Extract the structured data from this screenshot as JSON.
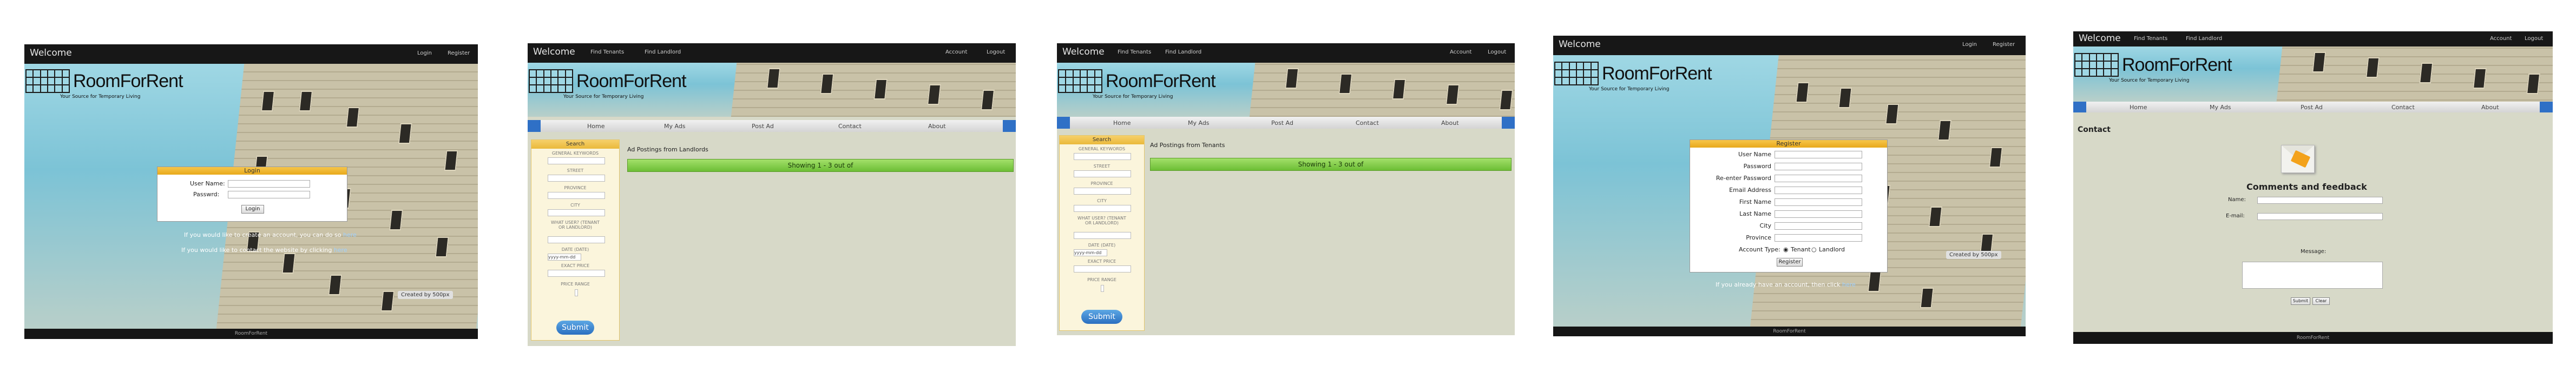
{
  "login_screen": {
    "welcome": "Welcome",
    "nav": [
      "Login",
      "Register"
    ],
    "logo_name": "RoomForRent",
    "logo_tagline": "Your Source for Temporary Living",
    "dialog_title": "Login",
    "username_label": "User Name:",
    "password_label": "Passwrd:",
    "login_button": "Login",
    "note1": "If you would like to create an account, you can do so",
    "note1_link": "here",
    "note2": "If you would like to contact the website by clicking",
    "note2_link": "here",
    "photo_credit": "Created by",
    "photo_credit_brand": "500px",
    "footer": "RoomForRent"
  },
  "listings_landlords": {
    "welcome": "Welcome",
    "nav": [
      "Find Tenants",
      "Find Landlord"
    ],
    "nav_right": [
      "Account",
      "Logout"
    ],
    "logo_name": "RoomForRent",
    "logo_tagline": "Your Source for Temporary Living",
    "menu": [
      "Home",
      "My Ads",
      "Post Ad",
      "Contact",
      "About"
    ],
    "search_title": "Search",
    "fields": [
      "GENERAL KEYWORDS",
      "STREET",
      "PROVINCE",
      "CITY",
      "WHAT USER? (TENANT OR LANDLORD)",
      "DATE (DATE)",
      "EXACT PRICE",
      "PRICE RANGE"
    ],
    "date_value": "yyyy-mm-dd",
    "submit": "Submit",
    "results_heading": "Ad Postings from Landlords",
    "showing": "Showing 1 - 3 out of"
  },
  "listings_tenants": {
    "welcome": "Welcome",
    "nav": [
      "Find Tenants",
      "Find Landlord"
    ],
    "nav_right": [
      "Account",
      "Logout"
    ],
    "logo_name": "RoomForRent",
    "logo_tagline": "Your Source for Temporary Living",
    "menu": [
      "Home",
      "My Ads",
      "Post Ad",
      "Contact",
      "About"
    ],
    "search_title": "Search",
    "fields": [
      "GENERAL KEYWORDS",
      "STREET",
      "PROVINCE",
      "CITY",
      "WHAT USER? (TENANT OR LANDLORD)",
      "DATE (DATE)",
      "EXACT PRICE",
      "PRICE RANGE"
    ],
    "date_value": "yyyy-mm-dd",
    "submit": "Submit",
    "results_heading": "Ad Postings from Tenants",
    "showing": "Showing 1 - 3 out of"
  },
  "register_screen": {
    "welcome": "Welcome",
    "nav": [
      "Login",
      "Register"
    ],
    "logo_name": "RoomForRent",
    "logo_tagline": "Your Source for Temporary Living",
    "dialog_title": "Register",
    "labels": [
      "User Name",
      "Password",
      "Re-enter Password",
      "Email Address",
      "First Name",
      "Last Name",
      "City",
      "Province"
    ],
    "account_type_label": "Account Type:",
    "account_type_options": [
      "Tenant",
      "Landlord"
    ],
    "register_button": "Register",
    "note": "If you already have an account, then click",
    "note_link": "here",
    "photo_credit": "Created by",
    "photo_credit_brand": "500px",
    "footer": "RoomForRent"
  },
  "contact_screen": {
    "welcome": "Welcome",
    "nav": [
      "Find Tenants",
      "Find Landlord"
    ],
    "nav_right": [
      "Account",
      "Logout"
    ],
    "logo_name": "RoomForRent",
    "logo_tagline": "Your Source for Temporary Living",
    "menu": [
      "Home",
      "My Ads",
      "Post Ad",
      "Contact",
      "About"
    ],
    "page_title": "Contact",
    "form_title": "Comments and feedback",
    "name_label": "Name:",
    "email_label": "E-mail:",
    "message_label": "Message:",
    "submit_button": "Submit",
    "clear_button": "Clear",
    "footer": "RoomForRent"
  },
  "colors": {
    "topbar": "#171717",
    "accent_yellow": "#eab93b",
    "accent_blue": "#2f70c6",
    "green_bar": "#6cbe35",
    "page_bg": "#d7d9c8"
  }
}
